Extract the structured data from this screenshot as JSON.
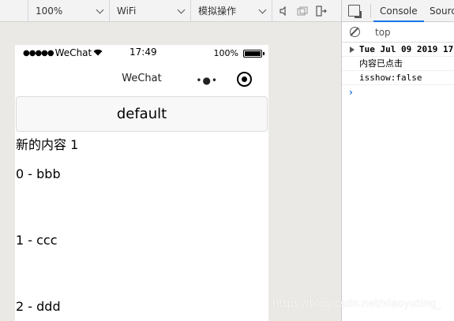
{
  "toolbar": {
    "zoom": "100%",
    "network": "WiFi",
    "operation": "模拟操作"
  },
  "phone": {
    "status": {
      "dots": "●●●●●",
      "carrier": "WeChat",
      "time": "17:49",
      "battery": "100%",
      "battery_level": 1.0
    },
    "nav": {
      "title": "WeChat",
      "more": "•●•"
    },
    "button_label": "default",
    "new_content": "新的内容 1",
    "items": [
      "0 - bbb",
      "1 - ccc",
      "2 - ddd"
    ]
  },
  "devtools": {
    "tabs": {
      "console": "Console",
      "sources": "Source"
    },
    "filter": "top",
    "log": [
      "Tue Jul 09 2019 17",
      "内容已点击",
      "isshow:false"
    ]
  },
  "watermark": "https://blog.csdn.net/xiaoyuting_"
}
